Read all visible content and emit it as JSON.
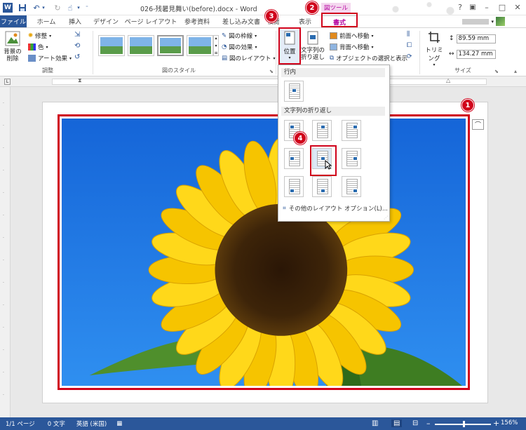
{
  "titlebar": {
    "doc_title": "026-残暑見舞い(before).docx - Word",
    "context_tab_group": "図ツール",
    "minimize": "–",
    "restore": "□",
    "close": "✕",
    "help": "?"
  },
  "tabs": {
    "file": "ファイル",
    "home": "ホーム",
    "insert": "挿入",
    "design": "デザイン",
    "page_layout": "ページ レイアウト",
    "references": "参考資料",
    "mailings": "差し込み文書",
    "review": "校閲",
    "view": "表示",
    "format": "書式"
  },
  "ribbon": {
    "remove_bg": "背景の削除",
    "corrections": "修整",
    "color": "色",
    "artistic": "アート効果",
    "group_adjust": "調整",
    "group_styles": "図のスタイル",
    "picture_border": "図の枠線",
    "picture_effects": "図の効果",
    "picture_layout": "図のレイアウト",
    "position": "位置",
    "wrap_text_line1": "文字列の",
    "wrap_text_line2": "折り返し",
    "bring_forward": "前面へ移動",
    "send_backward": "背面へ移動",
    "selection_pane": "オブジェクトの選択と表示",
    "crop": "トリミング",
    "height": "89.59 mm",
    "width": "134.27 mm",
    "group_size": "サイズ"
  },
  "dropdown": {
    "section_inline": "行内",
    "section_wrap": "文字列の折り返し",
    "more_options": "その他のレイアウト オプション(L)..."
  },
  "callouts": {
    "one": "1",
    "two": "2",
    "three": "3",
    "four": "4"
  },
  "status": {
    "page": "1/1 ページ",
    "words": "0 文字",
    "language": "英語 (米国)",
    "zoom": "156%"
  },
  "colors": {
    "word_blue": "#2b579a",
    "callout_red": "#d0021b",
    "format_magenta": "#b4009e",
    "sky_blue": "#1f7de0"
  }
}
